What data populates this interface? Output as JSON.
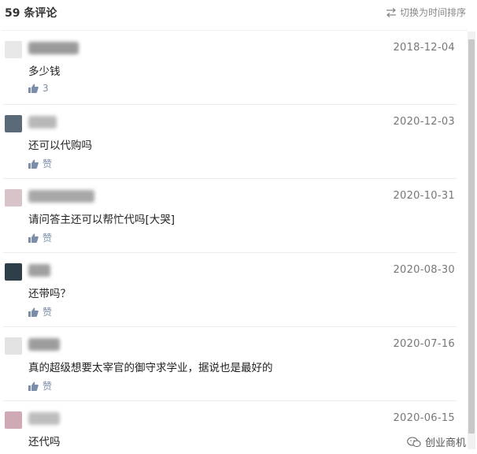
{
  "header": {
    "title": "59 条评论",
    "sort_label": "切换为时间排序"
  },
  "comments": [
    {
      "date": "2018-12-04",
      "text": "多少钱",
      "likes": "3",
      "avatar_color": "#e8e8e8",
      "name_color": "#9a9a9a"
    },
    {
      "date": "2020-12-03",
      "text": "还可以代购吗",
      "likes": "赞",
      "avatar_color": "#5a6a78",
      "name_color": "#b8b8b8"
    },
    {
      "date": "2020-10-31",
      "text": "请问答主还可以帮忙代吗[大哭]",
      "likes": "赞",
      "avatar_color": "#d7c3c8",
      "name_color": "#a8a8a8"
    },
    {
      "date": "2020-08-30",
      "text": "还带吗？",
      "likes": "赞",
      "avatar_color": "#2e3f4a",
      "name_color": "#a0a0a0"
    },
    {
      "date": "2020-07-16",
      "text": "真的超级想要太宰官的御守求学业，据说也是最好的",
      "likes": "赞",
      "avatar_color": "#e3e3e3",
      "name_color": "#9d9d9d"
    },
    {
      "date": "2020-06-15",
      "text": "还代吗",
      "likes": "",
      "avatar_color": "#cfa9b4",
      "name_color": "#bdbdbd"
    }
  ],
  "watermark": {
    "text": "创业商机"
  },
  "colors": {
    "like": "#7b8da8",
    "date": "#777777"
  }
}
